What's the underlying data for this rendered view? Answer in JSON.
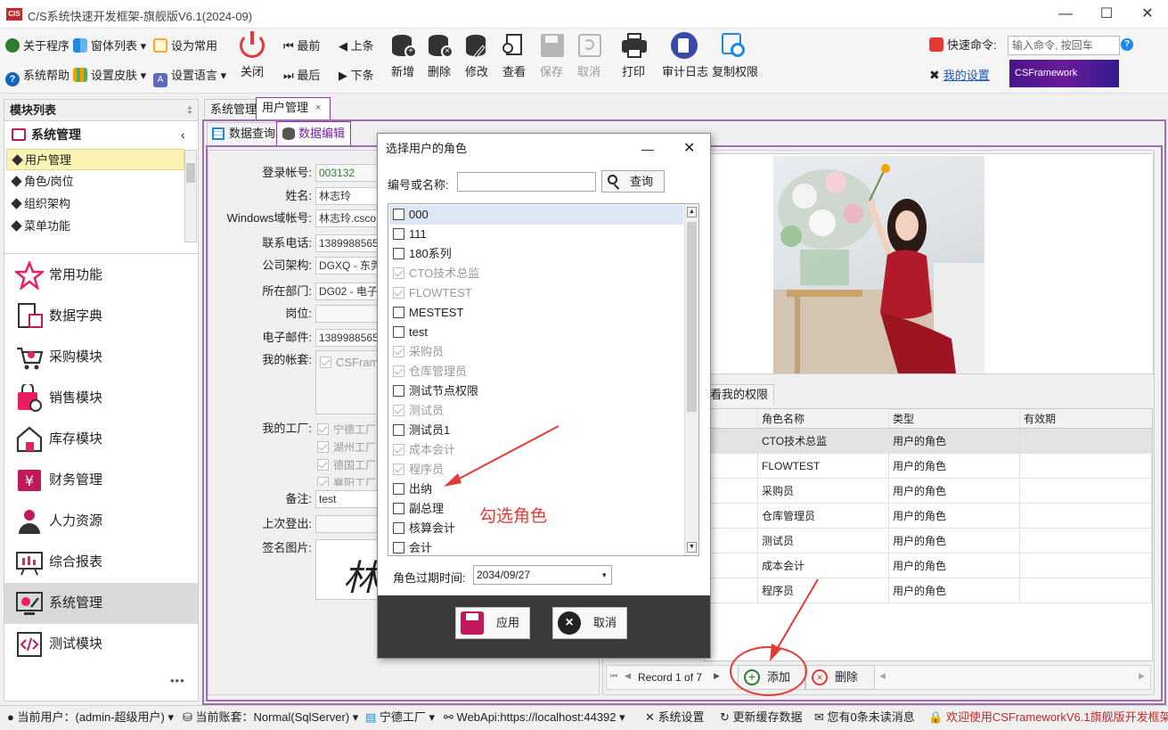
{
  "window": {
    "title": "C/S系统快速开发框架-旗舰版V6.1(2024-09)",
    "logo_text": "CIS"
  },
  "ribbon": {
    "small_buttons": [
      {
        "label": "关于程序"
      },
      {
        "label": "窗体列表"
      },
      {
        "label": "设为常用"
      },
      {
        "label": "系统帮助"
      },
      {
        "label": "设置皮肤"
      },
      {
        "label": "设置语言"
      }
    ],
    "close_label": "关闭",
    "nav": {
      "first": "最前",
      "prev": "上条",
      "last": "最后",
      "next": "下条"
    },
    "big_buttons": [
      {
        "label": "新增"
      },
      {
        "label": "删除"
      },
      {
        "label": "修改"
      },
      {
        "label": "查看"
      },
      {
        "label": "保存"
      },
      {
        "label": "取消"
      },
      {
        "label": "打印"
      },
      {
        "label": "审计日志"
      },
      {
        "label": "复制权限"
      }
    ],
    "quick_command_label": "快速命令:",
    "quick_command_placeholder": "输入命令, 按回车",
    "my_settings": "我的设置",
    "brand_text": "CSFramework"
  },
  "left_panel": {
    "title": "模块列表",
    "section": "系统管理",
    "tree_items": [
      "用户管理",
      "角色/岗位",
      "组织架构",
      "菜单功能"
    ],
    "nav_buttons": [
      {
        "label": "常用功能"
      },
      {
        "label": "数据字典"
      },
      {
        "label": "采购模块"
      },
      {
        "label": "销售模块"
      },
      {
        "label": "库存模块"
      },
      {
        "label": "财务管理"
      },
      {
        "label": "人力资源"
      },
      {
        "label": "综合报表"
      },
      {
        "label": "系统管理"
      },
      {
        "label": "测试模块"
      }
    ],
    "more": "•••"
  },
  "tabs": {
    "doc_tabs": [
      "系统管理",
      "用户管理"
    ],
    "sub_tabs": [
      "数据查询",
      "数据编辑"
    ]
  },
  "form": {
    "fields": [
      {
        "label": "登录帐号:",
        "value": "003132"
      },
      {
        "label": "姓名:",
        "value": "林志玲"
      },
      {
        "label": "Windows域帐号:",
        "value": "林志玲.csco"
      },
      {
        "label": "联系电话:",
        "value": "13899885656"
      },
      {
        "label": "公司架构:",
        "value": "DGXQ - 东莞"
      },
      {
        "label": "所在部门:",
        "value": "DG02 - 电子"
      },
      {
        "label": "岗位:",
        "value": ""
      },
      {
        "label": "电子邮件:",
        "value": "13899885656"
      }
    ],
    "account_label": "我的帐套:",
    "account_value": "CSFrame",
    "factory_label": "我的工厂:",
    "factories": [
      "宁德工厂",
      "湖州工厂",
      "德国工厂",
      "襄阳工厂"
    ],
    "remark_label": "备注:",
    "remark_value": "test",
    "last_logout_label": "上次登出:",
    "signature_label": "签名图片:",
    "signature_text": "林"
  },
  "roles_panel": {
    "tab_label": "看我的权限",
    "columns": [
      "角色名称",
      "类型",
      "有效期"
    ],
    "rows": [
      {
        "name": "CTO技术总监",
        "type": "用户的角色"
      },
      {
        "name": "FLOWTEST",
        "type": "用户的角色"
      },
      {
        "name": "采购员",
        "type": "用户的角色"
      },
      {
        "name": "仓库管理员",
        "type": "用户的角色"
      },
      {
        "name": "测试员",
        "type": "用户的角色"
      },
      {
        "name": "成本会计",
        "type": "用户的角色"
      },
      {
        "name": "程序员",
        "type": "用户的角色"
      }
    ],
    "record_text": "Record 1 of 7",
    "add_label": "添加",
    "delete_label": "删除"
  },
  "dialog": {
    "title": "选择用户的角色",
    "search_label": "编号或名称:",
    "search_value": "",
    "query_label": "查询",
    "items": [
      {
        "label": "000",
        "checked": false
      },
      {
        "label": "111",
        "checked": false
      },
      {
        "label": "180系列",
        "checked": false
      },
      {
        "label": "CTO技术总监",
        "checked": true
      },
      {
        "label": "FLOWTEST",
        "checked": true
      },
      {
        "label": "MESTEST",
        "checked": false
      },
      {
        "label": "test",
        "checked": false
      },
      {
        "label": "采购员",
        "checked": true
      },
      {
        "label": "仓库管理员",
        "checked": true
      },
      {
        "label": "测试节点权限",
        "checked": false
      },
      {
        "label": "测试员",
        "checked": true
      },
      {
        "label": "测试员1",
        "checked": false
      },
      {
        "label": "成本会计",
        "checked": true
      },
      {
        "label": "程序员",
        "checked": true
      },
      {
        "label": "出纳",
        "checked": false
      },
      {
        "label": "副总理",
        "checked": false
      },
      {
        "label": "核算会计",
        "checked": false
      },
      {
        "label": "会计",
        "checked": false
      }
    ],
    "expire_label": "角色过期时间:",
    "expire_value": "2034/09/27",
    "apply_label": "应用",
    "cancel_label": "取消"
  },
  "annotation": {
    "text": "勾选角色",
    "color": "#e53935"
  },
  "statusbar": {
    "user": "当前用户：(admin-超级用户)",
    "account": "当前账套：Normal(SqlServer)",
    "factory": "宁德工厂",
    "webapi": "WebApi:https://localhost:44392",
    "settings": "系统设置",
    "refresh": "更新缓存数据",
    "messages": "您有0条未读消息",
    "welcome": "欢迎使用CSFrameworkV6.1旗舰版开发框架"
  },
  "colors": {
    "accent_purple": "#9933aa",
    "icon_magenta": "#c2185b",
    "nav_icon_pink": "#e91e63",
    "close_red": "#e53935"
  }
}
